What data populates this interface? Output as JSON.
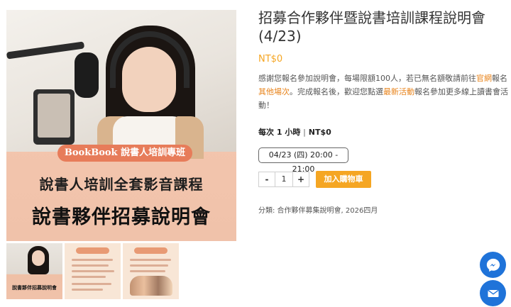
{
  "product": {
    "title": "招募合作夥伴暨說書培訓課程說明會 (4/23)",
    "price": "NT$0",
    "description": {
      "p1": "感謝您報名參加說明會，每場限額100人，若已無名額敬請前往",
      "link1": "官網",
      "p2": "報名",
      "link2": "其他場次",
      "p3": "。完成報名後，歡迎您點選",
      "link3": "最新活動",
      "p4": "報名參加更多線上讀書會活動！"
    },
    "frequency": "每次 1 小時",
    "frequency_sep": "|",
    "frequency_price": "NT$0",
    "session": "04/23 (四) 20:00 - 21:00",
    "quantity": "1",
    "minus": "-",
    "plus": "+",
    "add_to_cart": "加入購物車",
    "categories": "分類: 合作夥伴募集說明會, 2026四月"
  },
  "image": {
    "badge": "BookBook 說書人培訓專班",
    "line1": "說書人培訓全套影音課程",
    "line2": "說書夥伴招募說明會",
    "thumb1_text": "說書夥伴招募說明會"
  },
  "colors": {
    "accent": "#f5a623",
    "link": "#e8831a",
    "fab": "#1f73d9"
  },
  "icons": {
    "messenger": "messenger-icon",
    "mail": "mail-icon"
  }
}
